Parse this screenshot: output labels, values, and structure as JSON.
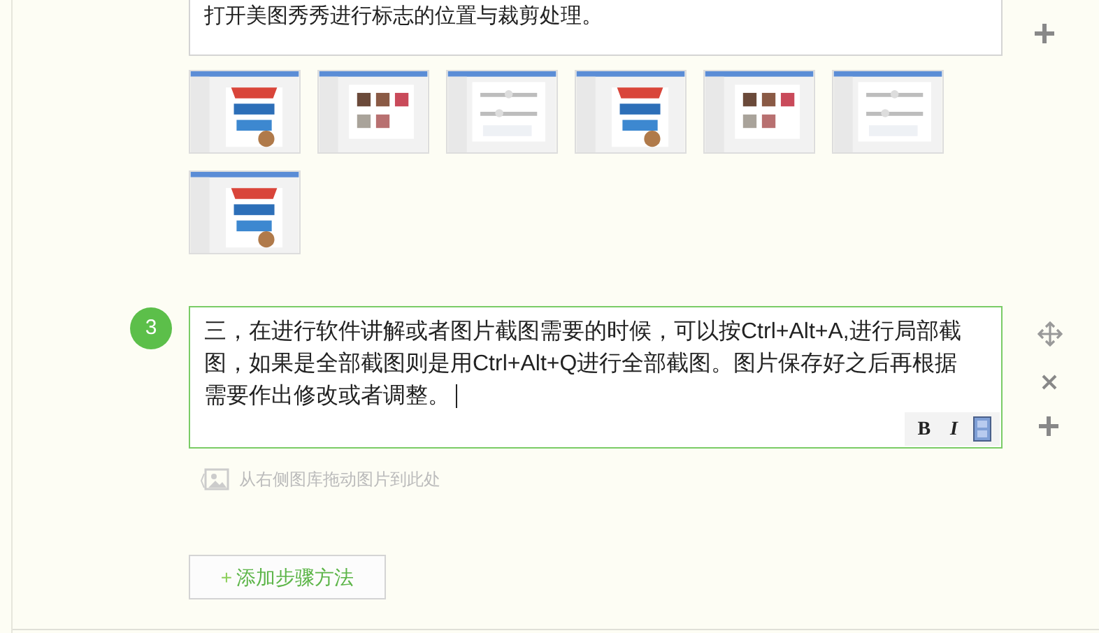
{
  "previous_step": {
    "text": "打开美图秀秀进行标志的位置与裁剪处理。"
  },
  "step": {
    "number": "3",
    "text": "三，在进行软件讲解或者图片截图需要的时候，可以按Ctrl+Alt+A,进行局部截图，如果是全部截图则是用Ctrl+Alt+Q进行全部截图。图片保存好之后再根据需要作出修改或者调整。",
    "focused": true,
    "toolbar": [
      {
        "kind": "bold",
        "label": "B"
      },
      {
        "kind": "italic",
        "label": "I"
      },
      {
        "kind": "film"
      }
    ],
    "hint": "从右侧图库拖动图片到此处"
  },
  "add_button": {
    "icon": "+",
    "label": "添加步骤方法"
  }
}
